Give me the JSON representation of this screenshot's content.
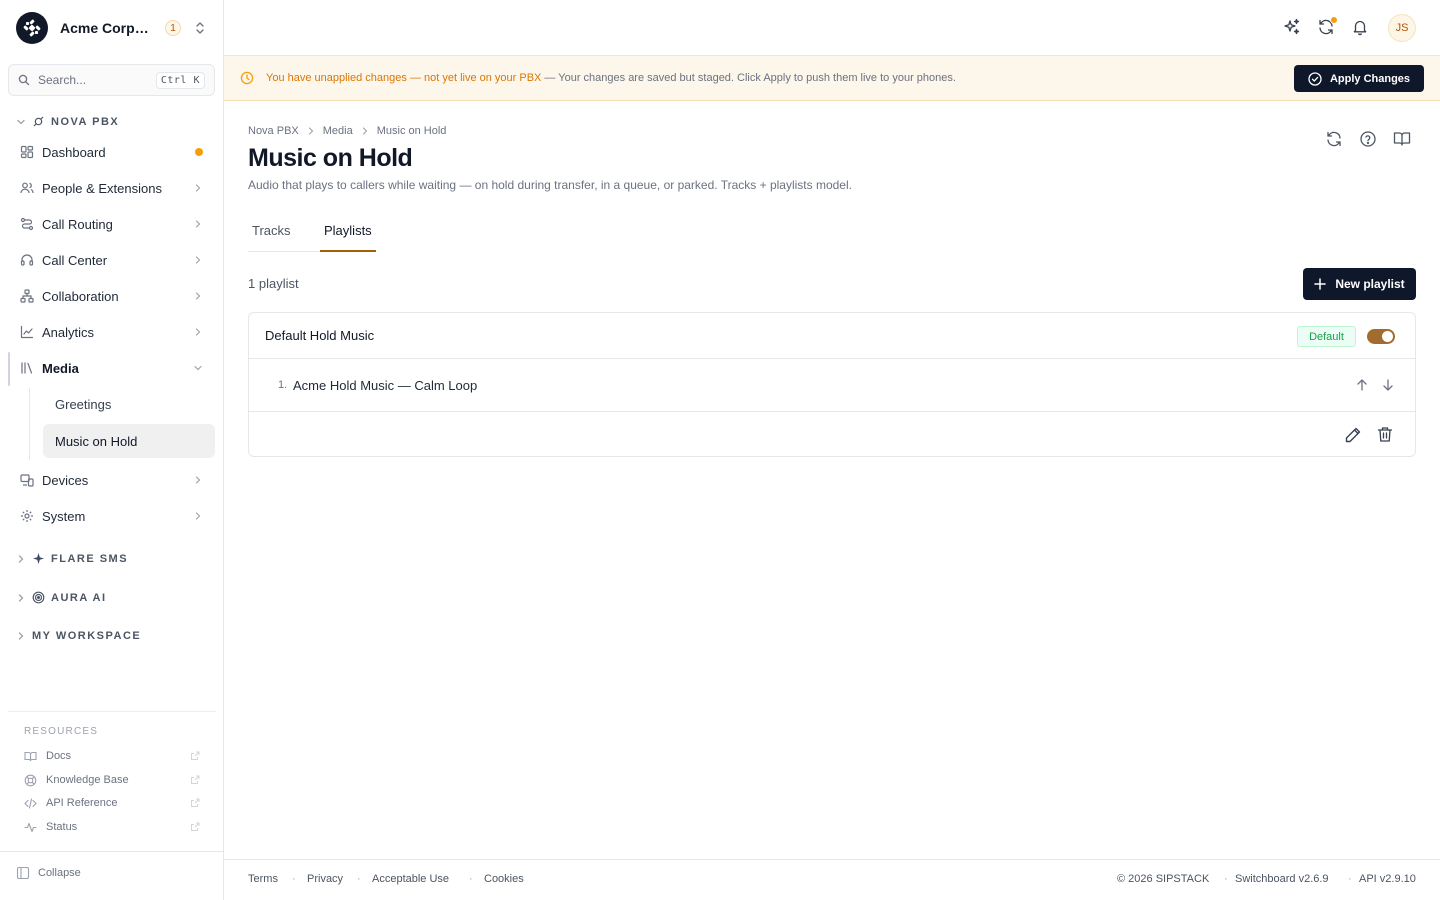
{
  "org": {
    "name": "Acme Corporation",
    "badge": "1"
  },
  "search": {
    "placeholder": "Search...",
    "shortcut": "Ctrl K"
  },
  "sidebar": {
    "nova_header": "NOVA PBX",
    "items": [
      {
        "label": "Dashboard"
      },
      {
        "label": "People & Extensions"
      },
      {
        "label": "Call Routing"
      },
      {
        "label": "Call Center"
      },
      {
        "label": "Collaboration"
      },
      {
        "label": "Analytics"
      },
      {
        "label": "Media"
      },
      {
        "label": "Devices"
      },
      {
        "label": "System"
      }
    ],
    "media_sub": [
      {
        "label": "Greetings"
      },
      {
        "label": "Music on Hold"
      }
    ],
    "flare_header": "FLARE SMS",
    "aura_header": "AURA AI",
    "workspace_header": "MY WORKSPACE",
    "resources_title": "RESOURCES",
    "resources": [
      {
        "label": "Docs"
      },
      {
        "label": "Knowledge Base"
      },
      {
        "label": "API Reference"
      },
      {
        "label": "Status"
      }
    ],
    "collapse_label": "Collapse"
  },
  "topbar": {
    "avatar_initials": "JS"
  },
  "banner": {
    "strong": "You have unapplied changes — not yet live on your PBX",
    "rest": "— Your changes are saved but staged. Click Apply to push them live to your phones.",
    "apply_label": "Apply Changes"
  },
  "breadcrumb": [
    "Nova PBX",
    "Media",
    "Music on Hold"
  ],
  "page": {
    "title": "Music on Hold",
    "subtitle": "Audio that plays to callers while waiting — on hold during transfer, in a queue, or parked. Tracks + playlists model."
  },
  "tabs": [
    {
      "label": "Tracks"
    },
    {
      "label": "Playlists"
    }
  ],
  "playlists": {
    "count": "1 playlist",
    "new_label": "New playlist",
    "items": [
      {
        "name": "Default Hold Music",
        "badge": "Default",
        "enabled": true,
        "tracks": [
          {
            "num": "1.",
            "name": "Acme Hold Music — Calm Loop"
          }
        ]
      }
    ]
  },
  "footer": {
    "links": [
      "Terms",
      "Privacy",
      "Acceptable Use",
      "Cookies"
    ],
    "copyright": "© 2026 SIPSTACK",
    "version": "Switchboard v2.6.9",
    "api": "API v2.9.10"
  }
}
